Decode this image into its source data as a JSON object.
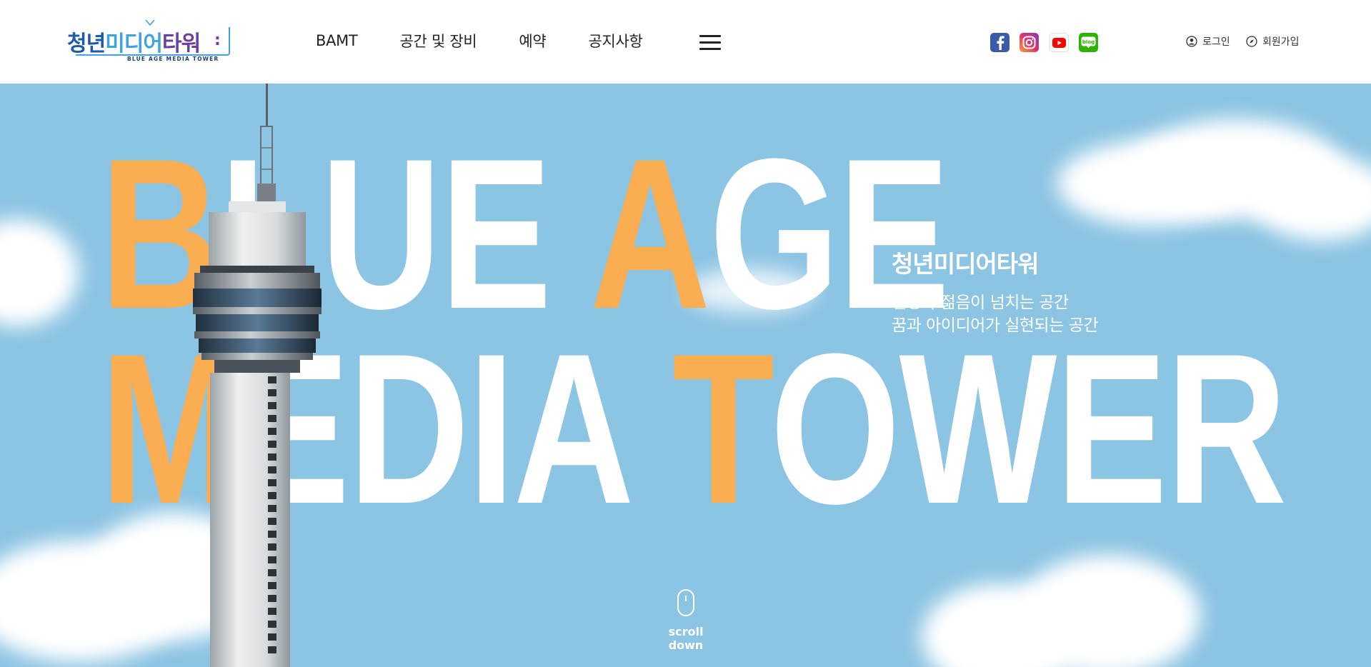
{
  "logo": {
    "title_part1": "청년",
    "title_part2": "미디어",
    "title_part3": "타워",
    "subtitle": "BLUE AGE MEDIA TOWER"
  },
  "nav": {
    "items": [
      {
        "label": "BAMT"
      },
      {
        "label": "공간 및 장비"
      },
      {
        "label": "예약"
      },
      {
        "label": "공지사항"
      }
    ],
    "menu_icon": "hamburger-icon"
  },
  "social": [
    {
      "name": "facebook",
      "icon": "facebook-icon",
      "color": "#3b5ba8"
    },
    {
      "name": "instagram",
      "icon": "instagram-icon",
      "color": "#e1306c"
    },
    {
      "name": "youtube",
      "icon": "youtube-icon",
      "color": "#ff0000"
    },
    {
      "name": "blog",
      "icon": "blog-icon",
      "label": "blog",
      "color": "#2db400"
    }
  ],
  "utility": {
    "login_label": "로그인",
    "login_icon": "user-icon",
    "join_label": "회원가입",
    "join_icon": "compass-icon"
  },
  "hero": {
    "line1_letters": [
      "B",
      "LUE ",
      "A",
      "GE"
    ],
    "line2_letters": [
      "M",
      "EDIA ",
      "T",
      "OWER"
    ],
    "title": "청년미디어타워",
    "lines": [
      "열정과 젊음이 넘치는 공간",
      "꿈과 아이디어가 실현되는 공간"
    ],
    "scroll_label": "scroll down",
    "background_color": "#8cc4e3",
    "accent_color": "#fbad51"
  }
}
